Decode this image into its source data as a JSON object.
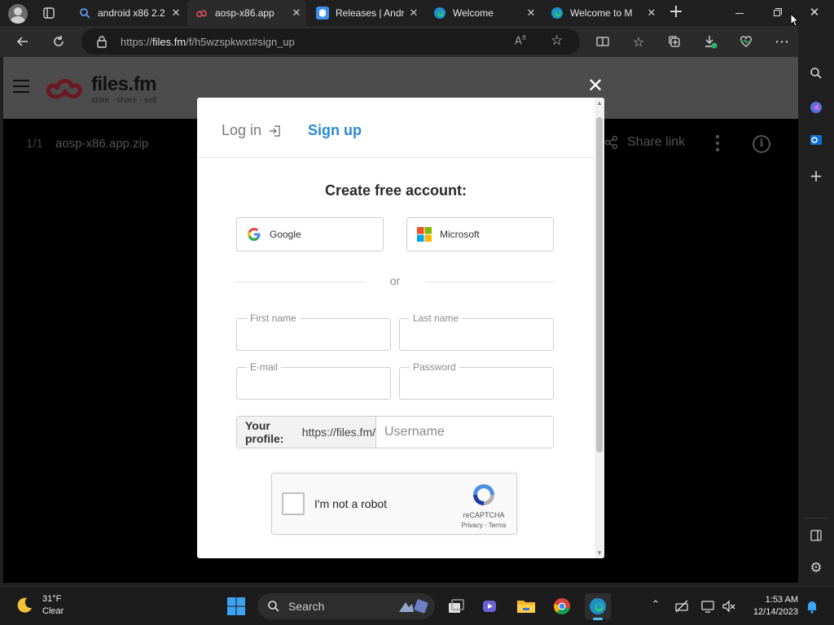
{
  "browser": {
    "tabs": [
      {
        "label": "android x86 2.2",
        "icon": "search-icon"
      },
      {
        "label": "aosp-x86.app",
        "icon": "files-fm-icon",
        "active": true
      },
      {
        "label": "Releases | Andr",
        "icon": "github-icon"
      },
      {
        "label": "Welcome",
        "icon": "edge-icon"
      },
      {
        "label": "Welcome to M",
        "icon": "edge-icon"
      }
    ],
    "close_glyph": "✕",
    "new_tab_glyph": "+",
    "address": {
      "url_prefix": "https://",
      "url_host": "files.fm",
      "url_path": "/f/h5wzspkwxt#sign_up"
    }
  },
  "site": {
    "brand": "files.fm",
    "tagline": "store · share · sell",
    "file_index": "1/1",
    "file_name": "aosp-x86.app.zip",
    "share_label": "Share link",
    "info_glyph": "i"
  },
  "modal": {
    "close_glyph": "✕",
    "tab_login": "Log in",
    "tab_signup": "Sign up",
    "title": "Create free account:",
    "oauth": {
      "google": "Google",
      "microsoft": "Microsoft"
    },
    "or_text": "or",
    "fields": {
      "first_name": "First name",
      "last_name": "Last name",
      "email": "E-mail",
      "password": "Password"
    },
    "profile": {
      "label": "Your profile:",
      "prefix": "https://files.fm/",
      "username_placeholder": "Username"
    },
    "recaptcha": {
      "label": "I'm not a robot",
      "brand": "reCAPTCHA",
      "links": "Privacy - Terms"
    }
  },
  "taskbar": {
    "weather_temp": "31°F",
    "weather_desc": "Clear",
    "search_label": "Search",
    "time": "1:53 AM",
    "date": "12/14/2023"
  },
  "colors": {
    "accent": "#2a8ad8",
    "brand_red": "#c0283a"
  }
}
